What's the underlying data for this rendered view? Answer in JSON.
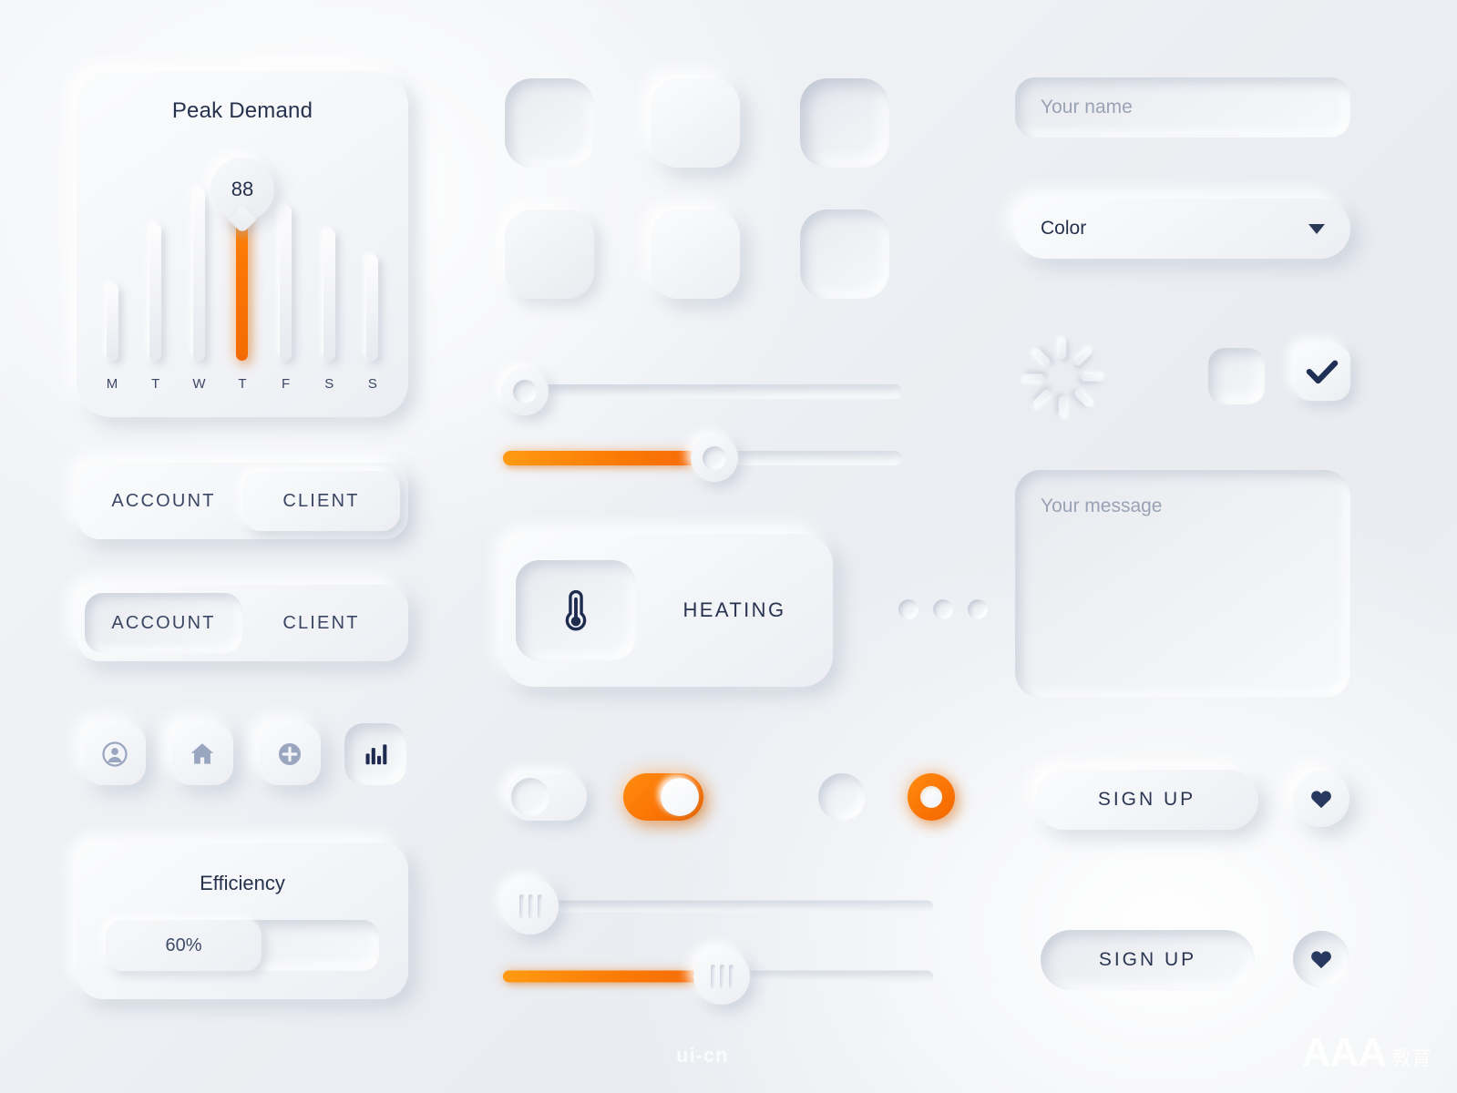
{
  "peak_card": {
    "title": "Peak Demand",
    "value": "88",
    "chart_data": {
      "type": "bar",
      "title": "Peak Demand",
      "categories": [
        "M",
        "T",
        "W",
        "T",
        "F",
        "S",
        "S"
      ],
      "values": [
        42,
        75,
        95,
        100,
        85,
        72,
        58
      ],
      "highlight_index": 3,
      "highlight_value": "88",
      "highlight_color": "#fb7505",
      "bar_color": "#f1f3f8",
      "xlabel": "",
      "ylabel": "",
      "ylim": [
        0,
        100
      ],
      "grid": false,
      "legend": "none"
    }
  },
  "segment_1": {
    "left_label": "ACCOUNT",
    "right_label": "CLIENT",
    "selected": "CLIENT"
  },
  "segment_2": {
    "left_label": "ACCOUNT",
    "right_label": "CLIENT",
    "selected": "ACCOUNT"
  },
  "icon_buttons": [
    {
      "name": "user-icon",
      "state": "raised"
    },
    {
      "name": "home-icon",
      "state": "raised"
    },
    {
      "name": "plus-circle-icon",
      "state": "raised"
    },
    {
      "name": "bar-chart-icon",
      "state": "inset"
    }
  ],
  "efficiency_card": {
    "title": "Efficiency",
    "value_label": "60%",
    "percent": 60
  },
  "tiles": [
    {
      "id": "tile-1",
      "style": "inset"
    },
    {
      "id": "tile-2",
      "style": "raised"
    },
    {
      "id": "tile-3",
      "style": "inset-deep"
    },
    {
      "id": "tile-4",
      "style": "raised-soft"
    },
    {
      "id": "tile-5",
      "style": "raised"
    },
    {
      "id": "tile-6",
      "style": "inset"
    }
  ],
  "sliders": {
    "slider_a": {
      "percent": 0,
      "filled": false
    },
    "slider_b": {
      "percent": 50,
      "filled": true
    },
    "slider_c": {
      "percent": 0,
      "filled": false
    },
    "slider_d": {
      "percent": 50,
      "filled": true
    }
  },
  "heating_card": {
    "label": "HEATING",
    "icon": "thermometer-icon"
  },
  "dots": {
    "count": 3
  },
  "toggles": {
    "off_label": "toggle-off",
    "on_label": "toggle-on"
  },
  "radios": {
    "off_label": "radio-off",
    "on_label": "radio-on"
  },
  "form": {
    "name_placeholder": "Your name",
    "select_value": "Color",
    "message_placeholder": "Your message"
  },
  "checkboxes": {
    "unchecked": "checkbox-empty",
    "checked": "checkbox-checked"
  },
  "signup": {
    "label_1": "SIGN UP",
    "label_2": "SIGN UP"
  },
  "watermarks": {
    "center": "ui-cn",
    "brand": "AAA",
    "brand_cn": "教育"
  },
  "colors": {
    "accent_orange": "#fb7505",
    "accent_orange_light": "#ff9a12",
    "text_navy": "#26324d",
    "text_muted": "#9aa2b5",
    "surface": "#eef0f4"
  }
}
